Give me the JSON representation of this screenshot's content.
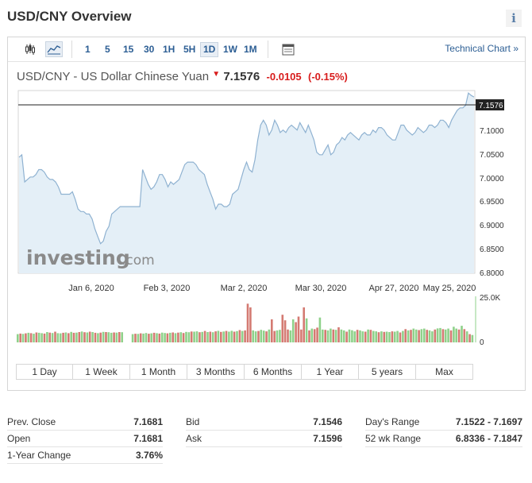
{
  "header": {
    "title": "USD/CNY Overview",
    "info_glyph": "i"
  },
  "toolbar": {
    "icons": [
      "candlestick-icon",
      "line-chart-icon",
      "calendar-icon"
    ],
    "intervals": [
      "1",
      "5",
      "15",
      "30",
      "1H",
      "5H",
      "1D",
      "1W",
      "1M"
    ],
    "active_interval": "1D",
    "technical_chart": "Technical Chart »"
  },
  "quote": {
    "name": "USD/CNY - US Dollar Chinese Yuan",
    "arrow": "▼",
    "price": "7.1576",
    "change": "-0.0105",
    "change_pct": "(-0.15%)"
  },
  "chart_data": {
    "type": "area",
    "x_tick_labels": [
      "Jan 6, 2020",
      "Feb 3, 2020",
      "Mar 2, 2020",
      "Mar 30, 2020",
      "Apr 27, 2020",
      "May 25, 2020"
    ],
    "y_tick_labels": [
      "7.1000",
      "7.0500",
      "7.0000",
      "6.9500",
      "6.9000",
      "6.8500",
      "6.8000"
    ],
    "ylim": [
      6.8,
      7.17
    ],
    "current_label": "7.1576",
    "current_value": 7.1576,
    "price_values": [
      7.035,
      7.04,
      6.985,
      6.99,
      6.995,
      6.995,
      7.0,
      7.01,
      7.01,
      7.005,
      6.995,
      6.99,
      6.99,
      6.985,
      6.975,
      6.96,
      6.96,
      6.96,
      6.96,
      6.965,
      6.95,
      6.93,
      6.925,
      6.925,
      6.92,
      6.92,
      6.91,
      6.89,
      6.875,
      6.86,
      6.865,
      6.885,
      6.895,
      6.92,
      6.925,
      6.93,
      6.935,
      6.935,
      6.935,
      6.935,
      6.935,
      6.935,
      6.935,
      6.935,
      7.01,
      6.995,
      6.98,
      6.97,
      6.975,
      6.985,
      7.0,
      7.0,
      6.99,
      6.975,
      6.985,
      6.98,
      6.985,
      6.99,
      7.005,
      7.02,
      7.025,
      7.025,
      7.025,
      7.02,
      7.01,
      7.005,
      7.0,
      6.98,
      6.965,
      6.95,
      6.93,
      6.94,
      6.94,
      6.935,
      6.935,
      6.94,
      6.96,
      6.965,
      6.97,
      6.99,
      7.01,
      7.025,
      7.01,
      7.005,
      7.03,
      7.07,
      7.1,
      7.11,
      7.1,
      7.08,
      7.09,
      7.11,
      7.1,
      7.085,
      7.09,
      7.085,
      7.095,
      7.1,
      7.095,
      7.09,
      7.105,
      7.095,
      7.085,
      7.1,
      7.085,
      7.07,
      7.045,
      7.04,
      7.04,
      7.05,
      7.06,
      7.04,
      7.045,
      7.06,
      7.065,
      7.075,
      7.07,
      7.08,
      7.085,
      7.08,
      7.075,
      7.07,
      7.08,
      7.085,
      7.08,
      7.08,
      7.09,
      7.085,
      7.095,
      7.095,
      7.09,
      7.08,
      7.075,
      7.07,
      7.07,
      7.085,
      7.1,
      7.1,
      7.09,
      7.085,
      7.08,
      7.085,
      7.095,
      7.09,
      7.085,
      7.09,
      7.1,
      7.1,
      7.095,
      7.1,
      7.11,
      7.11,
      7.105,
      7.095,
      7.11,
      7.12,
      7.13,
      7.135,
      7.135,
      7.14,
      7.165,
      7.16,
      7.157
    ],
    "volume_axis_labels": [
      "25.0K",
      "0"
    ],
    "volume_ylim": [
      0,
      25000
    ],
    "volume_values": [
      4500,
      4800,
      4600,
      4900,
      5200,
      5000,
      4700,
      5400,
      5200,
      5000,
      4800,
      5600,
      5300,
      5100,
      5800,
      5000,
      4900,
      5200,
      5400,
      5000,
      5700,
      5200,
      5300,
      5600,
      5900,
      5500,
      5400,
      5800,
      5600,
      5200,
      5000,
      5300,
      5700,
      5600,
      5500,
      5200,
      5400,
      5300,
      5600,
      5500,
      0,
      0,
      0,
      4500,
      4700,
      4600,
      4900,
      4800,
      5100,
      4700,
      4900,
      5200,
      5000,
      4800,
      5300,
      5100,
      4900,
      5200,
      5400,
      5000,
      5300,
      5500,
      5100,
      5700,
      5500,
      5900,
      5800,
      6000,
      5500,
      5700,
      6200,
      5600,
      5800,
      5500,
      6000,
      6300,
      5700,
      5900,
      6200,
      5800,
      6300,
      5800,
      6100,
      6700,
      6200,
      6500,
      21000,
      19000,
      6500,
      6000,
      6200,
      6800,
      6400,
      6000,
      7000,
      12500,
      6200,
      6500,
      6800,
      15000,
      12000,
      7000,
      6500,
      12500,
      11000,
      14000,
      7000,
      19000,
      13000,
      6500,
      7500,
      7200,
      8000,
      13500,
      7000,
      6800,
      6500,
      7500,
      7000,
      6800,
      8200,
      7000,
      6500,
      5800,
      7000,
      6600,
      6000,
      6800,
      6500,
      6000,
      5800,
      7000,
      6800,
      6200,
      6000,
      5500,
      6000,
      5700,
      5800,
      5600,
      6000,
      5800,
      6200,
      5400,
      6200,
      7200,
      6500,
      6800,
      7500,
      7000,
      6700,
      7200,
      7500,
      6800,
      6500,
      6000,
      7000,
      7600,
      7800,
      7200,
      7000,
      7500,
      6500,
      8500,
      7500,
      7000,
      9000,
      7200,
      6000,
      4500,
      4000
    ],
    "volume_colors": [
      "g",
      "r",
      "g",
      "r",
      "g",
      "r",
      "g",
      "r",
      "g",
      "g",
      "r",
      "g",
      "r",
      "g",
      "r",
      "g",
      "g",
      "r",
      "g",
      "r",
      "g",
      "r",
      "g",
      "r",
      "g",
      "r",
      "g",
      "r",
      "g",
      "r",
      "g",
      "r",
      "g",
      "r",
      "g",
      "g",
      "r",
      "g",
      "r",
      "g",
      "n",
      "n",
      "n",
      "g",
      "r",
      "g",
      "r",
      "g",
      "g",
      "r",
      "g",
      "r",
      "g",
      "r",
      "g",
      "g",
      "r",
      "g",
      "r",
      "g",
      "r",
      "g",
      "r",
      "g",
      "g",
      "r",
      "g",
      "g",
      "r",
      "g",
      "r",
      "g",
      "r",
      "g",
      "r",
      "g",
      "r",
      "g",
      "r",
      "g",
      "g",
      "r",
      "g",
      "r",
      "g",
      "r",
      "r",
      "r",
      "g",
      "g",
      "r",
      "g",
      "g",
      "r",
      "g",
      "r",
      "r",
      "g",
      "g",
      "r",
      "r",
      "r",
      "g",
      "g",
      "r",
      "r",
      "r",
      "r",
      "g",
      "r",
      "g",
      "r",
      "r",
      "g",
      "g",
      "r",
      "g",
      "g",
      "r",
      "g",
      "r",
      "g",
      "g",
      "r",
      "g",
      "g",
      "g",
      "r",
      "g",
      "g",
      "r",
      "g",
      "r",
      "g",
      "g",
      "r",
      "g",
      "r",
      "g",
      "g",
      "r",
      "g",
      "g",
      "r",
      "g",
      "r",
      "g",
      "r",
      "g",
      "g",
      "r",
      "g",
      "g",
      "r",
      "g",
      "g",
      "r",
      "g",
      "g",
      "r",
      "g",
      "g",
      "r",
      "g",
      "g",
      "r",
      "g",
      "r",
      "g",
      "r"
    ],
    "watermark": "investing",
    "watermark_suffix": ".com",
    "colors": {
      "area_fill": "#e4eff7",
      "line": "#8fb2d1",
      "up_volume": "#8fd18a",
      "down_volume": "#d47a72",
      "current_line": "#222222"
    }
  },
  "ranges": [
    "1 Day",
    "1 Week",
    "1 Month",
    "3 Months",
    "6 Months",
    "1 Year",
    "5 years",
    "Max"
  ],
  "stats": {
    "col1": [
      {
        "label": "Prev. Close",
        "value": "7.1681"
      },
      {
        "label": "Open",
        "value": "7.1681"
      },
      {
        "label": "1-Year Change",
        "value": "3.76%"
      }
    ],
    "col2": [
      {
        "label": "Bid",
        "value": "7.1546"
      },
      {
        "label": "Ask",
        "value": "7.1596"
      }
    ],
    "col3": [
      {
        "label": "Day's Range",
        "value": "7.1522 - 7.1697"
      },
      {
        "label": "52 wk Range",
        "value": "6.8336 - 7.1847"
      }
    ]
  }
}
